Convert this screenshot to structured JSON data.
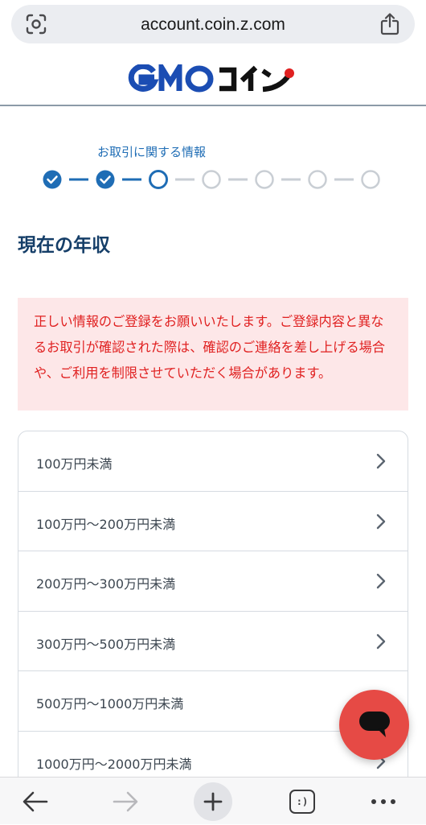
{
  "browser": {
    "url": "account.coin.z.com",
    "icons": {
      "left": "screen-capture-icon",
      "right": "share-icon"
    }
  },
  "header": {
    "logo_text": "GMOコイン"
  },
  "stepper": {
    "label": "お取引に関する情報",
    "total_steps": 7,
    "completed_steps": 2,
    "current_step": 3
  },
  "page": {
    "title": "現在の年収"
  },
  "warning": {
    "text": "正しい情報のご登録をお願いいたします。ご登録内容と異なるお取引が確認された際は、確認のご連絡を差し上げる場合や、ご利用を制限させていただく場合があります。"
  },
  "income_options": [
    {
      "label": "100万円未満"
    },
    {
      "label": "100万円〜200万円未満"
    },
    {
      "label": "200万円〜300万円未満"
    },
    {
      "label": "300万円〜500万円未満"
    },
    {
      "label": "500万円〜1000万円未満"
    },
    {
      "label": "1000万円〜2000万円未満"
    }
  ],
  "toolbar": {
    "tabs_label": ":)",
    "icons": [
      "back-arrow-icon",
      "forward-arrow-icon",
      "new-tab-plus-icon",
      "tabs-icon",
      "more-icon"
    ]
  },
  "colors": {
    "accent": "#1f6db5",
    "title": "#153e68",
    "warning_text": "#e02020",
    "warning_bg": "#fde7e8",
    "chat_fab": "#e64a45"
  }
}
